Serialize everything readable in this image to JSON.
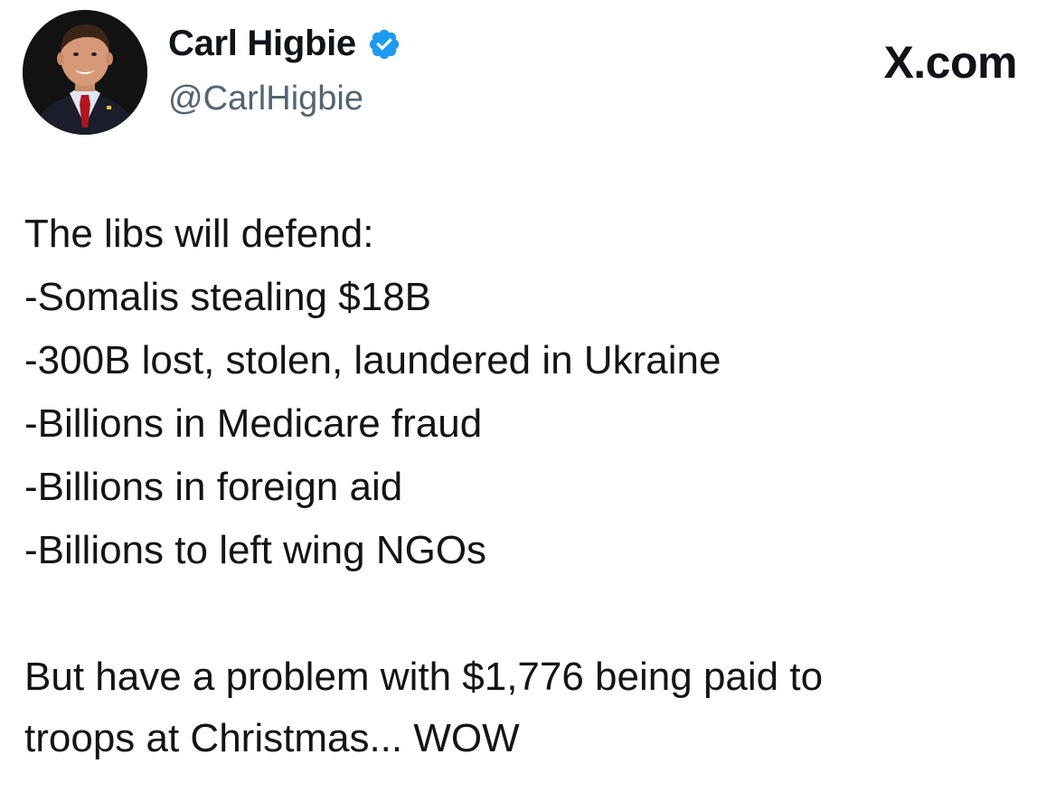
{
  "profile": {
    "display_name": "Carl Higbie",
    "handle": "@CarlHigbie",
    "verified_icon": "verified-badge-icon",
    "verified_color": "#1d9bf0",
    "avatar_icon": "profile-photo"
  },
  "brand": {
    "label": "X.com"
  },
  "tweet": {
    "lines": [
      "The libs will defend:",
      "-Somalis stealing $18B",
      "-300B lost, stolen, laundered in Ukraine",
      "-Billions in Medicare fraud",
      "-Billions in foreign aid",
      "-Billions to left wing NGOs"
    ],
    "closing": [
      "But have a problem with $1,776 being paid to",
      "troops at Christmas... WOW"
    ]
  }
}
